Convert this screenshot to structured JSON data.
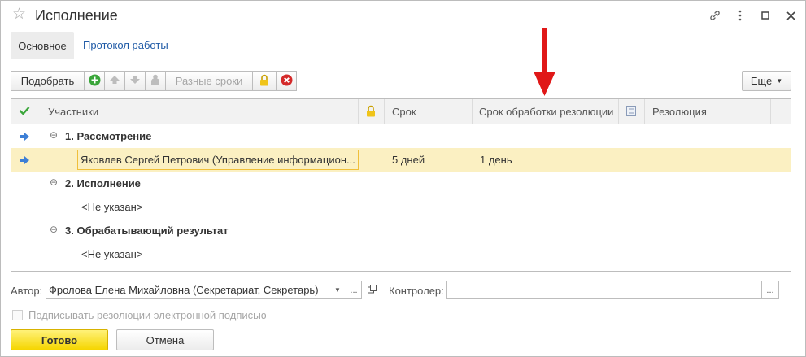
{
  "window": {
    "title": "Исполнение"
  },
  "tabs": {
    "main_label": "Основное",
    "protocol_link": "Протокол работы"
  },
  "toolbar": {
    "pick_label": "Подобрать",
    "dates_label": "Разные сроки",
    "more_label": "Еще"
  },
  "table": {
    "headers": {
      "participants": "Участники",
      "term": "Срок",
      "processing_term": "Срок обработки резолюции",
      "resolution": "Резолюция"
    },
    "rows": [
      {
        "kind": "group",
        "label": "1. Рассмотрение",
        "term": "",
        "processing_term": ""
      },
      {
        "kind": "item",
        "label": "Яковлев Сергей Петрович (Управление информацион...",
        "term": "5 дней",
        "processing_term": "1 день"
      },
      {
        "kind": "group",
        "label": "2. Исполнение",
        "term": "",
        "processing_term": ""
      },
      {
        "kind": "item",
        "label": "<Не указан>",
        "term": "",
        "processing_term": ""
      },
      {
        "kind": "group",
        "label": "3. Обрабатывающий результат",
        "term": "",
        "processing_term": ""
      },
      {
        "kind": "item",
        "label": "<Не указан>",
        "term": "",
        "processing_term": ""
      }
    ]
  },
  "form": {
    "author_label": "Автор:",
    "author_value": "Фролова Елена Михайловна (Секретариат, Секретарь)",
    "controller_label": "Контролер:",
    "controller_value": "",
    "sign_checkbox_label": "Подписывать резолюции электронной подписью"
  },
  "buttons": {
    "ok_label": "Готово",
    "cancel_label": "Отмена"
  },
  "colors": {
    "selected_row": "#fbf0c2",
    "ok_button": "#f5d500",
    "link": "#1f5aa6",
    "annotation_arrow": "#e01818"
  },
  "icons": [
    "star-icon",
    "link-icon",
    "kebab-menu-icon",
    "maximize-icon",
    "close-icon",
    "add-icon",
    "move-up-icon",
    "move-down-icon",
    "person-icon",
    "lock-icon",
    "delete-icon",
    "check-icon",
    "note-icon",
    "current-row-arrow-icon"
  ]
}
